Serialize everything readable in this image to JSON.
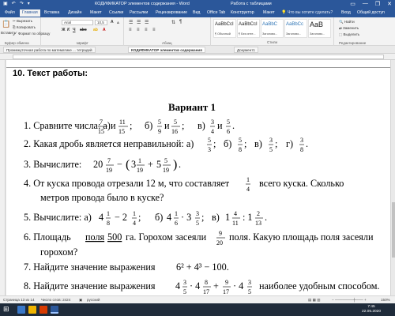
{
  "window": {
    "title": "КОДИФИКАТОР элементов содержания - Word",
    "context_tab": "Работа с таблицами",
    "controls": [
      "—",
      "❐",
      "✕"
    ]
  },
  "ribbon_tabs": [
    {
      "label": "Файл"
    },
    {
      "label": "Главная"
    },
    {
      "label": "Вставка"
    },
    {
      "label": "Дизайн"
    },
    {
      "label": "Макет"
    },
    {
      "label": "Ссылки"
    },
    {
      "label": "Рассылки"
    },
    {
      "label": "Рецензирование"
    },
    {
      "label": "Вид"
    },
    {
      "label": "Office Tab"
    },
    {
      "label": "Конструктор"
    },
    {
      "label": "Макет"
    }
  ],
  "tell_me": "Что вы хотите сделать?",
  "account": {
    "signin": "Вход",
    "share": "Общий доступ"
  },
  "clipboard": {
    "paste": "Вставить",
    "cut": "Вырезать",
    "copy": "Копировать",
    "format_painter": "Формат по образцу",
    "group": "Буфер обмена"
  },
  "font": {
    "name": "Arial",
    "size": "10,5",
    "group": "Шрифт"
  },
  "paragraph": {
    "group": "Абзац"
  },
  "styles": {
    "items": [
      {
        "preview": "AaBbCcI",
        "name": "¶ Обычный"
      },
      {
        "preview": "AaBbCcI",
        "name": "¶ Без инте..."
      },
      {
        "preview": "AaBbC",
        "name": "Заголово..."
      },
      {
        "preview": "AaBbCc",
        "name": "Заголово..."
      },
      {
        "preview": "AaB",
        "name": "Заголово..."
      }
    ],
    "group": "Стили"
  },
  "editing": {
    "find": "Найти",
    "replace": "Заменить",
    "select": "Выделить",
    "group": "Редактирование"
  },
  "doc_tabs": [
    {
      "label": "Промежуточная работа по математике ... тетрадей"
    },
    {
      "label": "КОДИФИКАТОР элементов содержания"
    },
    {
      "label": "Документ1"
    }
  ],
  "document": {
    "section_heading": "10. Текст работы:",
    "variant": "Вариант 1",
    "tasks": {
      "t1_a": "1. Сравните числа:  а)",
      "t1_b": "б)",
      "t1_c": "в)",
      "t2": "2. Какая дробь является неправильной:  а)",
      "t2_b": "б)",
      "t2_c": "в)",
      "t2_d": "г)",
      "t3": "3. Вычислите:",
      "t4_a": "4. От куска провода отрезали 12 м, что составляет",
      "t4_b": "всего куска. Сколько",
      "t4_c": "метров провода было в куске?",
      "t5": "5. Вычислите: а)",
      "t5_b": "б)",
      "t5_c": "в)",
      "t6_a": "6. Площадь",
      "t6_field": "поля",
      "t6_area": "500",
      "t6_b": "га. Горохом засеяли",
      "t6_c": "поля. Какую площадь поля засеяли",
      "t6_d": "горохом?",
      "t7": "7. Найдите значение выражения",
      "t7_expr": "6² + 4³ − 100.",
      "t8": "8. Найдите значение выражения",
      "t8_end": "наиболее удобным способом."
    }
  },
  "status_bar": {
    "page": "Страница 13 из 14",
    "words": "Число слов: 2424",
    "lang": "русский",
    "zoom": "150%"
  },
  "taskbar": {
    "time": "7:45",
    "date": "22.05.2020"
  }
}
